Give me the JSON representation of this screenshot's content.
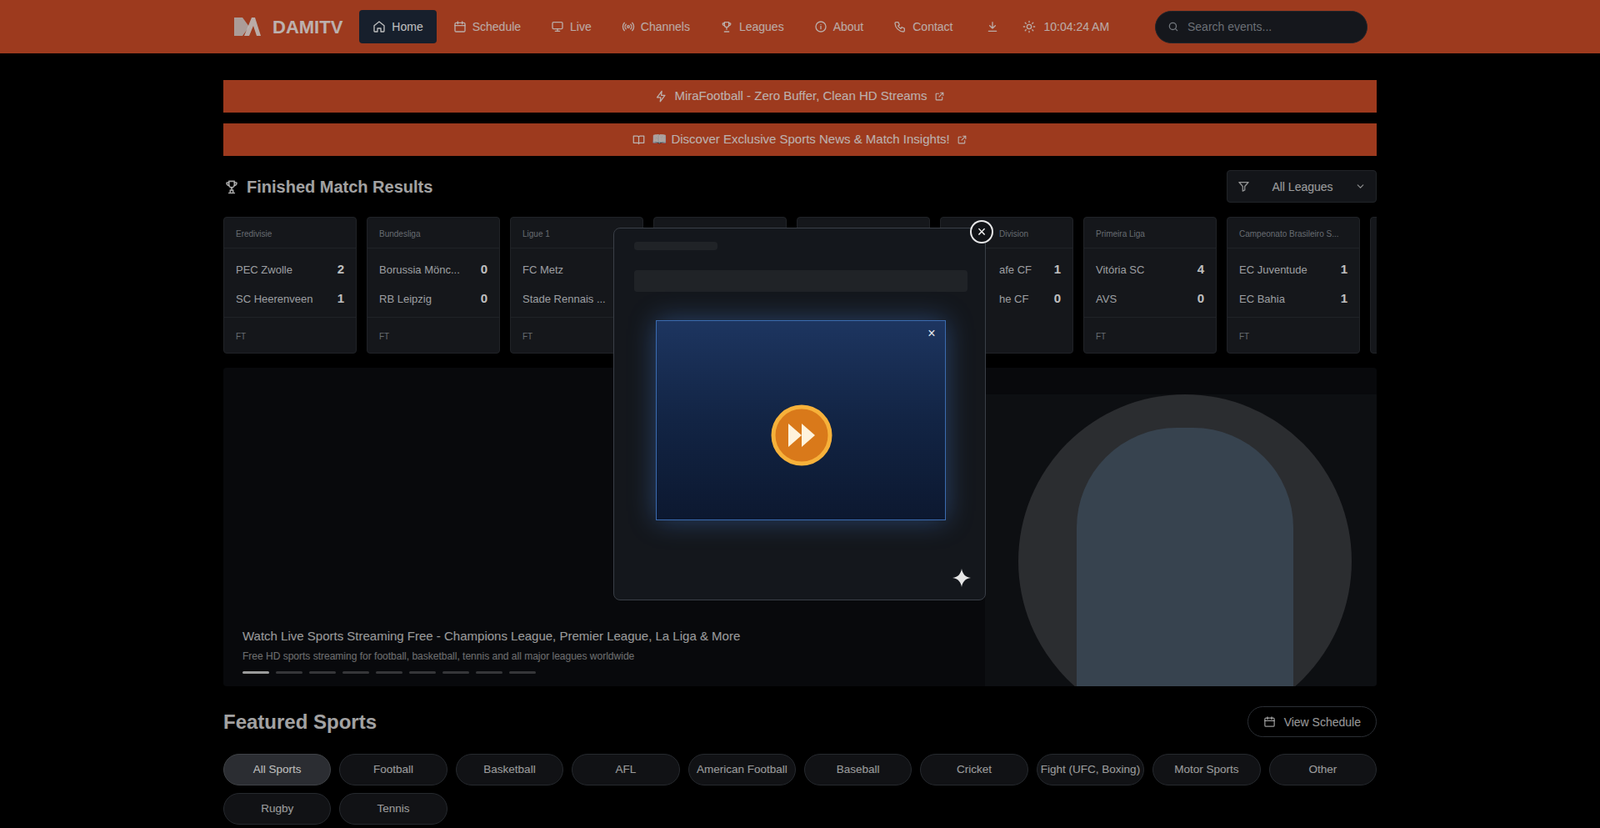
{
  "site": {
    "logo": "DAMITV"
  },
  "nav": [
    {
      "label": "Home",
      "selected": true
    },
    {
      "label": "Schedule",
      "selected": false
    },
    {
      "label": "Live",
      "selected": false
    },
    {
      "label": "Channels",
      "selected": false
    },
    {
      "label": "Leagues",
      "selected": false
    },
    {
      "label": "About",
      "selected": false
    },
    {
      "label": "Contact",
      "selected": false
    }
  ],
  "header": {
    "time": "10:04:24 AM"
  },
  "search": {
    "placeholder": "Search events..."
  },
  "banners": [
    "MiraFootball - Zero Buffer, Clean HD Streams",
    "📖 Discover Exclusive Sports News & Match Insights!"
  ],
  "results": {
    "title": "Finished Match Results",
    "filter": "All Leagues",
    "cards": [
      {
        "kind": "full",
        "league": "Eredivisie",
        "teams": [
          {
            "name": "PEC Zwolle",
            "score": "2"
          },
          {
            "name": "SC Heerenveen",
            "score": "1"
          }
        ],
        "status": "FT"
      },
      {
        "kind": "full",
        "league": "Bundesliga",
        "teams": [
          {
            "name": "Borussia Mönc...",
            "score": "0"
          },
          {
            "name": "RB Leipzig",
            "score": "0"
          }
        ],
        "status": "FT"
      },
      {
        "kind": "full",
        "league": "Ligue 1",
        "teams": [
          {
            "name": "FC Metz",
            "score": ""
          },
          {
            "name": "Stade Rennais ...",
            "score": ""
          }
        ],
        "status": "FT"
      },
      {
        "kind": "hidden"
      },
      {
        "kind": "hidden"
      },
      {
        "kind": "partial",
        "league": "Division",
        "teams": [
          {
            "name": "afe CF",
            "score": "1"
          },
          {
            "name": "he CF",
            "score": "0"
          }
        ],
        "status": ""
      },
      {
        "kind": "full",
        "league": "Primeira Liga",
        "teams": [
          {
            "name": "Vitória SC",
            "score": "4"
          },
          {
            "name": "AVS",
            "score": "0"
          }
        ],
        "status": "FT"
      },
      {
        "kind": "full",
        "league": "Campeonato Brasileiro S...",
        "teams": [
          {
            "name": "EC Juventude",
            "score": "1"
          },
          {
            "name": "EC Bahia",
            "score": "1"
          }
        ],
        "status": "FT"
      },
      {
        "kind": "hidden"
      }
    ]
  },
  "hero": {
    "title": "Watch Live Sports Streaming Free - Champions League, Premier League, La Liga & More",
    "subtitle": "Free HD sports streaming for football, basketball, tennis and all major leagues worldwide",
    "slides": [
      {
        "selected": true
      },
      {
        "selected": false
      },
      {
        "selected": false
      },
      {
        "selected": false
      },
      {
        "selected": false
      },
      {
        "selected": false
      },
      {
        "selected": false
      },
      {
        "selected": false
      },
      {
        "selected": false
      }
    ]
  },
  "featured": {
    "title": "Featured Sports",
    "button": "View Schedule",
    "sports": [
      {
        "label": "All Sports",
        "selected": true
      },
      {
        "label": "Football",
        "selected": false
      },
      {
        "label": "Basketball",
        "selected": false
      },
      {
        "label": "AFL",
        "selected": false
      },
      {
        "label": "American Football",
        "selected": false
      },
      {
        "label": "Baseball",
        "selected": false
      },
      {
        "label": "Cricket",
        "selected": false
      },
      {
        "label": "Fight (UFC, Boxing)",
        "selected": false
      },
      {
        "label": "Motor Sports",
        "selected": false
      },
      {
        "label": "Other",
        "selected": false
      },
      {
        "label": "Rugby",
        "selected": false
      },
      {
        "label": "Tennis",
        "selected": false
      }
    ]
  },
  "modal": {
    "close": "×",
    "ad_close": "×"
  }
}
